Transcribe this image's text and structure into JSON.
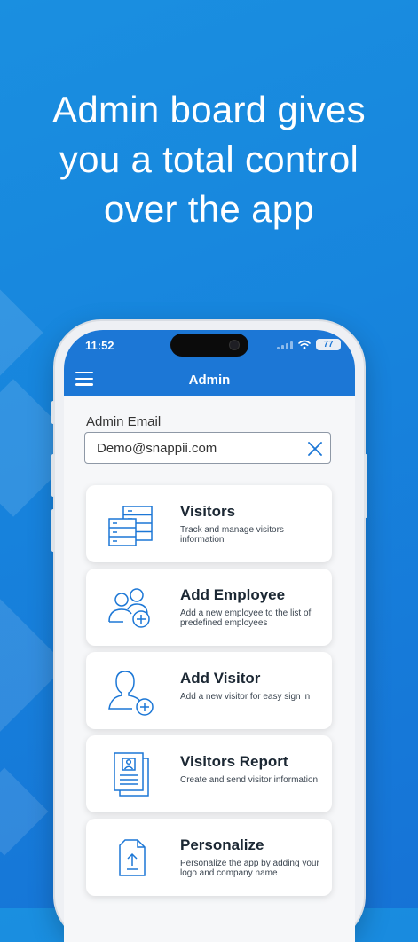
{
  "headline": {
    "lines": [
      "Admin board gives",
      "you a total control",
      "over the app"
    ]
  },
  "status_bar": {
    "time": "11:52",
    "battery": "77"
  },
  "app_bar": {
    "title": "Admin",
    "menu_icon": "hamburger-menu-icon"
  },
  "email": {
    "label": "Admin Email",
    "value": "Demo@snappii.com",
    "clear_icon": "close-icon"
  },
  "menu_cards": [
    {
      "title": "Visitors",
      "description": "Track and manage visitors information",
      "icon": "visitors-list-icon"
    },
    {
      "title": "Add Employee",
      "description": "Add a new employee to the list of predefined employees",
      "icon": "add-employee-icon"
    },
    {
      "title": "Add Visitor",
      "description": "Add a new visitor for easy sign in",
      "icon": "add-visitor-icon"
    },
    {
      "title": "Visitors Report",
      "description": "Create and send visitor information",
      "icon": "report-icon"
    },
    {
      "title": "Personalize",
      "description": "Personalize the app by adding your logo and company name",
      "icon": "upload-file-icon"
    }
  ],
  "colors": {
    "background": "#1785dd",
    "accent": "#1c77d6",
    "icon_stroke": "#1c77d6"
  }
}
